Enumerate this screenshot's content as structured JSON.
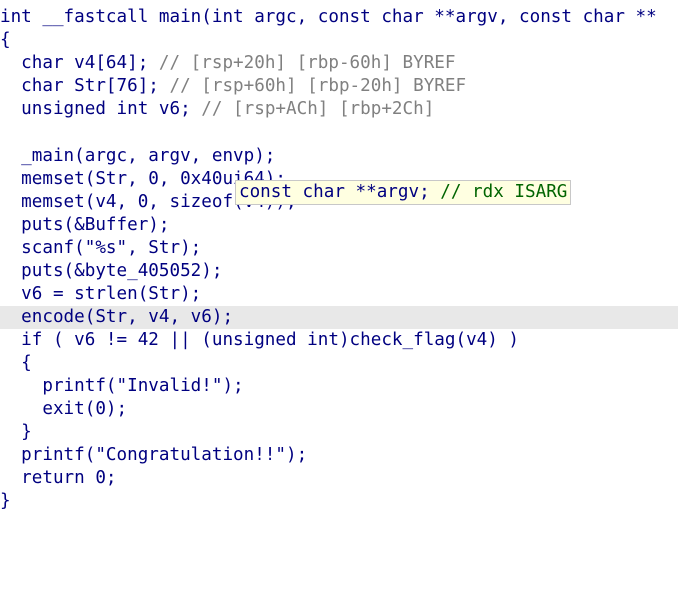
{
  "code": {
    "signature": "int __fastcall main(int argc, const char **argv, const char **",
    "open_brace": "{",
    "decl1": {
      "code": "  char v4[64]; ",
      "comment": "// [rsp+20h] [rbp-60h] BYREF"
    },
    "decl2": {
      "code": "  char Str[76]; ",
      "comment": "// [rsp+60h] [rbp-20h] BYREF"
    },
    "decl3": {
      "code": "  unsigned int v6; ",
      "comment": "// [rsp+ACh] [rbp+2Ch]"
    },
    "l_main": "  _main(argc, argv, envp);",
    "l_memset1": "  memset(Str, 0, 0x40ui64);",
    "l_memset2": "  memset(v4, 0, sizeof(v4));",
    "l_puts1": "  puts(&Buffer);",
    "l_scanf": "  scanf(\"%s\", Str);",
    "l_puts2": "  puts(&byte_405052);",
    "l_strlen": "  v6 = strlen(Str);",
    "l_encode": "  encode(Str, v4, v6);",
    "l_if": "  if ( v6 != 42 || (unsigned int)check_flag(v4) )",
    "l_brace_open2": "  {",
    "l_printf_invalid": "    printf(\"Invalid!\");",
    "l_exit": "    exit(0);",
    "l_brace_close2": "  }",
    "l_printf_congrats": "  printf(\"Congratulation!!\");",
    "l_return": "  return 0;",
    "close_brace": "}"
  },
  "tooltip": {
    "code": "const char **argv; ",
    "comment": "// rdx ISARG"
  },
  "colors": {
    "code": "#000080",
    "variable": "#606060",
    "comment": "#006400",
    "highlight": "#e8e8e8",
    "tooltip_bg": "#ffffe1"
  }
}
